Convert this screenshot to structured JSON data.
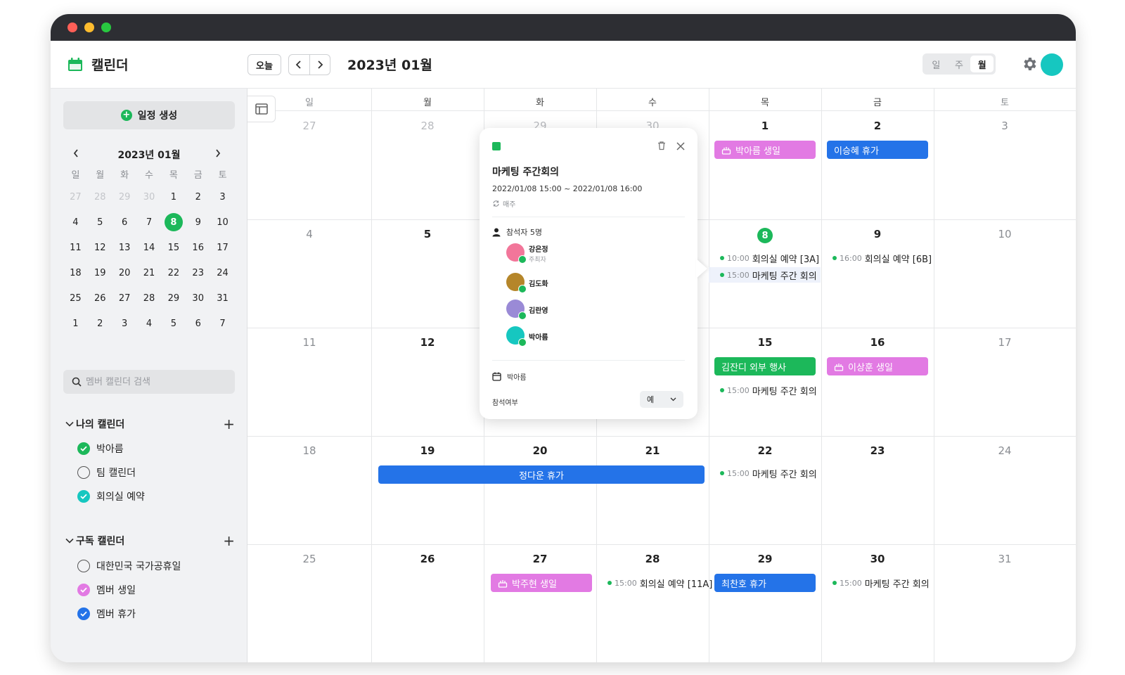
{
  "app": {
    "title": "캘린더",
    "accent": "#1cb85a"
  },
  "header": {
    "today_label": "오늘",
    "prev_icon": "chevron-left-icon",
    "next_icon": "chevron-right-icon",
    "month_title": "2023년 01월",
    "views": [
      {
        "label": "일",
        "active": false
      },
      {
        "label": "주",
        "active": false
      },
      {
        "label": "월",
        "active": true
      }
    ],
    "settings_icon": "gear-icon"
  },
  "sidebar": {
    "create_label": "일정 생성",
    "mini_calendar": {
      "title": "2023년 01월",
      "weekdays": [
        "일",
        "월",
        "화",
        "수",
        "목",
        "금",
        "토"
      ],
      "days": [
        {
          "d": "27",
          "faded": true
        },
        {
          "d": "28",
          "faded": true
        },
        {
          "d": "29",
          "faded": true
        },
        {
          "d": "30",
          "faded": true
        },
        {
          "d": "1"
        },
        {
          "d": "2"
        },
        {
          "d": "3"
        },
        {
          "d": "4"
        },
        {
          "d": "5"
        },
        {
          "d": "6"
        },
        {
          "d": "7"
        },
        {
          "d": "8",
          "today": true
        },
        {
          "d": "9"
        },
        {
          "d": "10"
        },
        {
          "d": "11"
        },
        {
          "d": "12"
        },
        {
          "d": "13"
        },
        {
          "d": "14"
        },
        {
          "d": "15"
        },
        {
          "d": "16"
        },
        {
          "d": "17"
        },
        {
          "d": "18"
        },
        {
          "d": "19"
        },
        {
          "d": "20"
        },
        {
          "d": "21"
        },
        {
          "d": "22"
        },
        {
          "d": "23"
        },
        {
          "d": "24"
        },
        {
          "d": "25"
        },
        {
          "d": "26"
        },
        {
          "d": "27"
        },
        {
          "d": "28"
        },
        {
          "d": "29"
        },
        {
          "d": "30"
        },
        {
          "d": "31"
        },
        {
          "d": "1"
        },
        {
          "d": "2"
        },
        {
          "d": "3"
        },
        {
          "d": "4"
        },
        {
          "d": "5"
        },
        {
          "d": "6"
        },
        {
          "d": "7"
        }
      ]
    },
    "search_placeholder": "멤버 캘린더 검색",
    "my_calendars": {
      "title": "나의 캘린더",
      "items": [
        {
          "label": "박아름",
          "checked": true,
          "color": "#1cb85a"
        },
        {
          "label": "팀 캘린더",
          "checked": false,
          "color": "#555555"
        },
        {
          "label": "회의실 예약",
          "checked": true,
          "color": "#16c7c0"
        }
      ]
    },
    "subscribed_calendars": {
      "title": "구독 캘린더",
      "items": [
        {
          "label": "대한민국 국가공휴일",
          "checked": false,
          "color": "#555555"
        },
        {
          "label": "멤버 생일",
          "checked": true,
          "color": "#e27ae3"
        },
        {
          "label": "멤버 휴가",
          "checked": true,
          "color": "#2473e8"
        }
      ]
    }
  },
  "month": {
    "weekdays": [
      "일",
      "월",
      "화",
      "수",
      "목",
      "금",
      "토"
    ],
    "weeks": [
      [
        "27",
        "28",
        "29",
        "30",
        "1",
        "2",
        "3"
      ],
      [
        "4",
        "5",
        "6",
        "7",
        "8",
        "9",
        "10"
      ],
      [
        "11",
        "12",
        "13",
        "14",
        "15",
        "16",
        "17"
      ],
      [
        "18",
        "19",
        "20",
        "21",
        "22",
        "23",
        "24"
      ],
      [
        "25",
        "26",
        "27",
        "28",
        "29",
        "30",
        "31"
      ]
    ],
    "events": {
      "e1": {
        "label": "박아름 생일",
        "color": "#e27ae3"
      },
      "e2": {
        "label": "이승혜 휴가",
        "color": "#2473e8"
      },
      "e3": {
        "time": "10:00",
        "label": "회의실 예약 [3A]"
      },
      "e4": {
        "time": "15:00",
        "label": "마케팅 주간 회의"
      },
      "e5": {
        "time": "16:00",
        "label": "회의실 예약 [6B]"
      },
      "e6": {
        "label": "김잔디 외부 행사",
        "color": "#1cb85a"
      },
      "e7": {
        "label": "이상훈 생일",
        "color": "#e27ae3"
      },
      "e8": {
        "time": "15:00",
        "label": "마케팅 주간 회의"
      },
      "e9": {
        "label": "정다운 휴가",
        "color": "#2473e8"
      },
      "e10": {
        "time": "15:00",
        "label": "마케팅 주간 회의"
      },
      "e11": {
        "label": "박주현 생일",
        "color": "#e27ae3"
      },
      "e12": {
        "time": "15:00",
        "label": "회의실 예약 [11A]"
      },
      "e13": {
        "label": "최찬호 휴가",
        "color": "#2473e8"
      },
      "e14": {
        "time": "15:00",
        "label": "마케팅 주간 회의"
      }
    }
  },
  "popup": {
    "title": "마케팅 주간회의",
    "datetime": "2022/01/08  15:00 ~ 2022/01/08  16:00",
    "repeat": "매주",
    "attendees_label": "참석자 5명",
    "attendees": [
      {
        "name": "강은정",
        "role": "주최자",
        "color": "#f2769a"
      },
      {
        "name": "김도화",
        "color": "#b5862a"
      },
      {
        "name": "김란영",
        "color": "#9a8ad6"
      },
      {
        "name": "박아름",
        "color": "#16c7c0"
      }
    ],
    "calendar_name": "박아름",
    "rsvp_label": "참석여부",
    "rsvp_value": "예"
  }
}
